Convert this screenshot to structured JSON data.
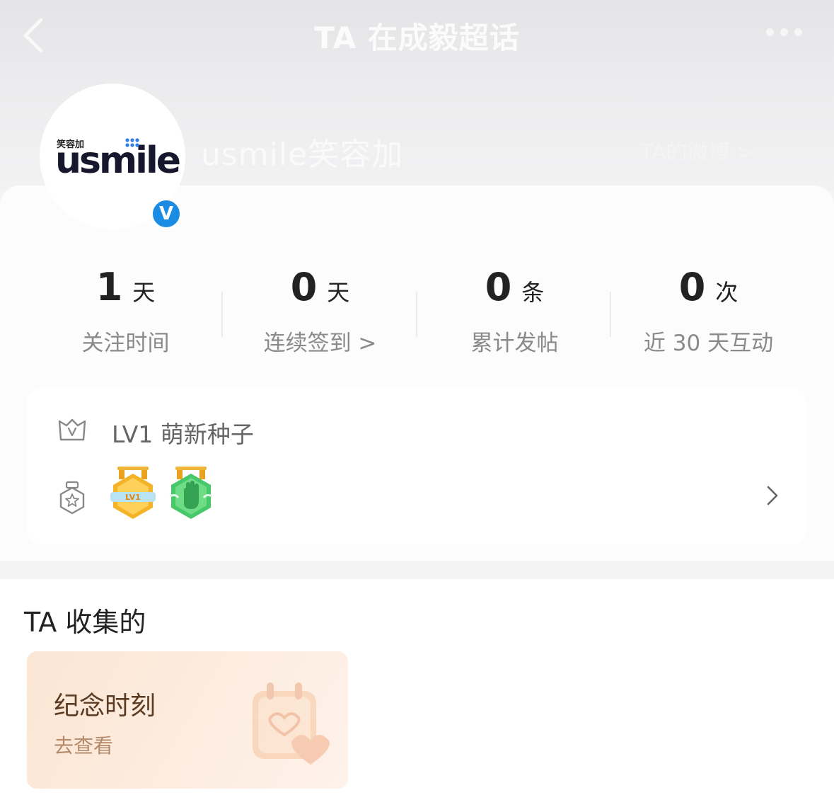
{
  "nav": {
    "title": "TA 在成毅超话",
    "back_icon": "back-arrow-icon",
    "more_icon": "more-dots-icon"
  },
  "profile": {
    "avatar_small_text": "笑容加",
    "avatar_logo_text": "usmile",
    "verified_icon": "V",
    "username": "usmile笑容加",
    "weibo_link": "TA的微博 >"
  },
  "stats": [
    {
      "value": "1",
      "unit": "天",
      "label": "关注时间"
    },
    {
      "value": "0",
      "unit": "天",
      "label": "连续签到 >"
    },
    {
      "value": "0",
      "unit": "条",
      "label": "累计发帖"
    },
    {
      "value": "0",
      "unit": "次",
      "label": "近 30 天互动"
    }
  ],
  "level": {
    "text": "LV1 萌新种子",
    "badges": [
      "LV1",
      "wave-hand"
    ]
  },
  "collect": {
    "title": "TA 收集的",
    "card_title": "纪念时刻",
    "card_sub": "去查看"
  },
  "colors": {
    "verified": "#1b8ce3",
    "badge_gold": "#f5b427",
    "badge_green": "#47c86a"
  }
}
